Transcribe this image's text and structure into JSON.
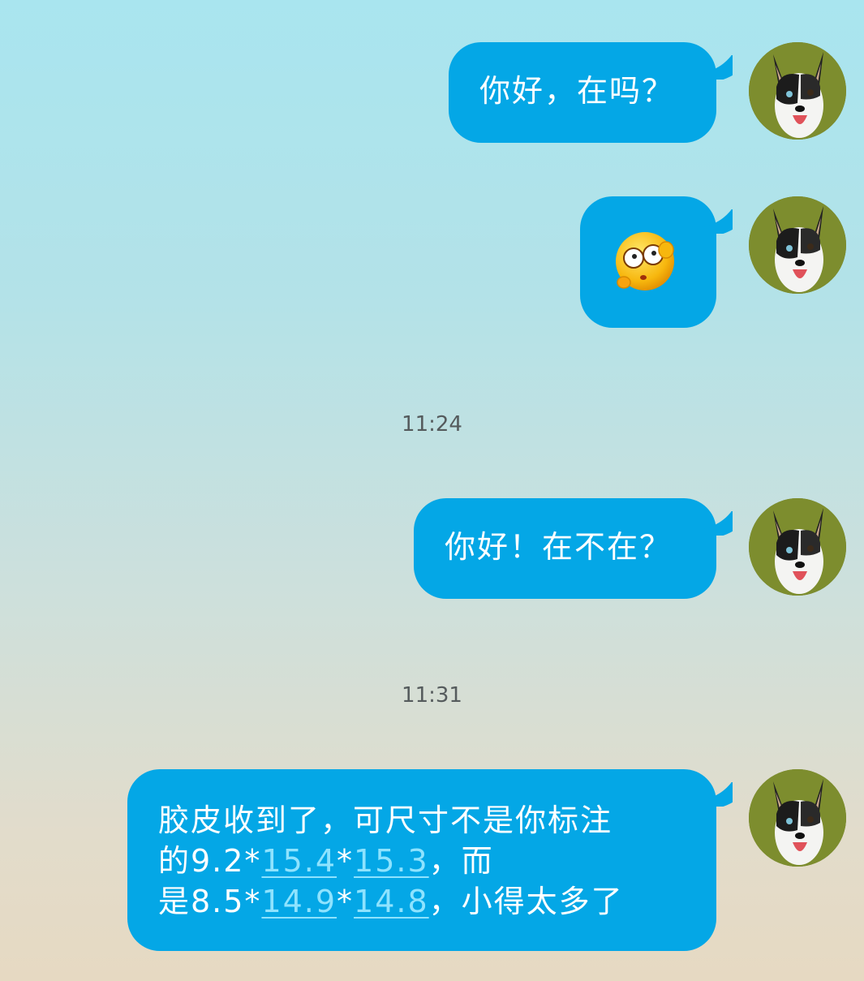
{
  "messages": [
    {
      "type": "text",
      "text": "你好，在吗？"
    },
    {
      "type": "emoji",
      "emoji": "flushed-face-emoji"
    },
    {
      "type": "text",
      "text": "你好！在不在？"
    },
    {
      "type": "rich",
      "line1": "胶皮收到了，可尺寸不是你标注",
      "line2_prefix": "的9.2*",
      "line2_link1": "15.4",
      "line2_sep": "*",
      "line2_link2": "15.3",
      "line2_suffix": "，而",
      "line3_prefix": "是8.5*",
      "line3_link1": "14.9",
      "line3_sep": "*",
      "line3_link2": "14.8",
      "line3_suffix": "，小得太多了"
    }
  ],
  "timestamps": [
    "11:24",
    "11:31"
  ],
  "colors": {
    "bubble": "#04a7e6",
    "link": "#8ee3ff",
    "timestamp": "#555b5d"
  },
  "avatar_icon": "husky-dog-avatar"
}
